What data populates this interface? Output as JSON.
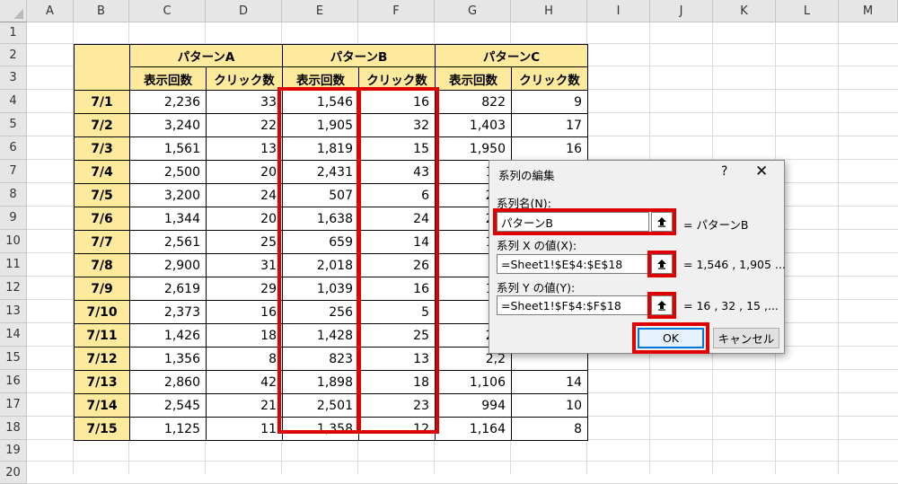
{
  "columns": [
    "A",
    "B",
    "C",
    "D",
    "E",
    "F",
    "G",
    "H",
    "I",
    "J",
    "K",
    "L",
    "M"
  ],
  "rows": [
    "1",
    "2",
    "3",
    "4",
    "5",
    "6",
    "7",
    "8",
    "9",
    "10",
    "11",
    "12",
    "13",
    "14",
    "15",
    "16",
    "17",
    "18",
    "19",
    "20"
  ],
  "table": {
    "groups": [
      "パターンA",
      "パターンB",
      "パターンC"
    ],
    "subheaders": [
      "表示回数",
      "クリック数",
      "表示回数",
      "クリック数",
      "表示回数",
      "クリック数"
    ],
    "rows": [
      {
        "date": "7/1",
        "c": "2,236",
        "d": "33",
        "e": "1,546",
        "f": "16",
        "g": "822",
        "h": "9"
      },
      {
        "date": "7/2",
        "c": "3,240",
        "d": "22",
        "e": "1,905",
        "f": "32",
        "g": "1,403",
        "h": "17"
      },
      {
        "date": "7/3",
        "c": "1,561",
        "d": "13",
        "e": "1,819",
        "f": "15",
        "g": "1,950",
        "h": "16"
      },
      {
        "date": "7/4",
        "c": "2,500",
        "d": "20",
        "e": "2,431",
        "f": "43",
        "g": "1,2",
        "h": ""
      },
      {
        "date": "7/5",
        "c": "3,200",
        "d": "24",
        "e": "507",
        "f": "6",
        "g": "2,5",
        "h": ""
      },
      {
        "date": "7/6",
        "c": "1,344",
        "d": "20",
        "e": "1,638",
        "f": "24",
        "g": "2,4",
        "h": ""
      },
      {
        "date": "7/7",
        "c": "2,561",
        "d": "25",
        "e": "659",
        "f": "14",
        "g": "1,2",
        "h": ""
      },
      {
        "date": "7/8",
        "c": "2,900",
        "d": "31",
        "e": "2,018",
        "f": "26",
        "g": "6",
        "h": ""
      },
      {
        "date": "7/9",
        "c": "2,619",
        "d": "29",
        "e": "1,039",
        "f": "16",
        "g": "1,9",
        "h": ""
      },
      {
        "date": "7/10",
        "c": "2,373",
        "d": "16",
        "e": "256",
        "f": "5",
        "g": "8",
        "h": ""
      },
      {
        "date": "7/11",
        "c": "1,426",
        "d": "18",
        "e": "1,428",
        "f": "25",
        "g": "2,6",
        "h": ""
      },
      {
        "date": "7/12",
        "c": "1,356",
        "d": "8",
        "e": "823",
        "f": "13",
        "g": "2,2",
        "h": ""
      },
      {
        "date": "7/13",
        "c": "2,860",
        "d": "42",
        "e": "1,898",
        "f": "18",
        "g": "1,106",
        "h": "14"
      },
      {
        "date": "7/14",
        "c": "2,545",
        "d": "21",
        "e": "2,501",
        "f": "23",
        "g": "994",
        "h": "10"
      },
      {
        "date": "7/15",
        "c": "1,125",
        "d": "11",
        "e": "1,358",
        "f": "12",
        "g": "1,164",
        "h": "8"
      }
    ]
  },
  "dialog": {
    "title": "系列の編集",
    "help": "?",
    "close": "✕",
    "series_name_label": "系列名(N):",
    "series_name_value": "パターンB",
    "series_name_result": "= パターンB",
    "x_label": "系列 X の値(X):",
    "x_value": "=Sheet1!$E$4:$E$18",
    "x_result": "= 1,546 , 1,905 ...",
    "y_label": "系列 Y の値(Y):",
    "y_value": "=Sheet1!$F$4:$F$18",
    "y_result": "= 16 , 32 , 15 ,...",
    "ok_label": "OK",
    "cancel_label": "キャンセル"
  },
  "colors": {
    "header_fill": "#fdea9c",
    "highlight": "#e00000",
    "ok_border": "#0078d7"
  },
  "icons": [
    "range-select-icon",
    "help-icon",
    "close-icon"
  ]
}
